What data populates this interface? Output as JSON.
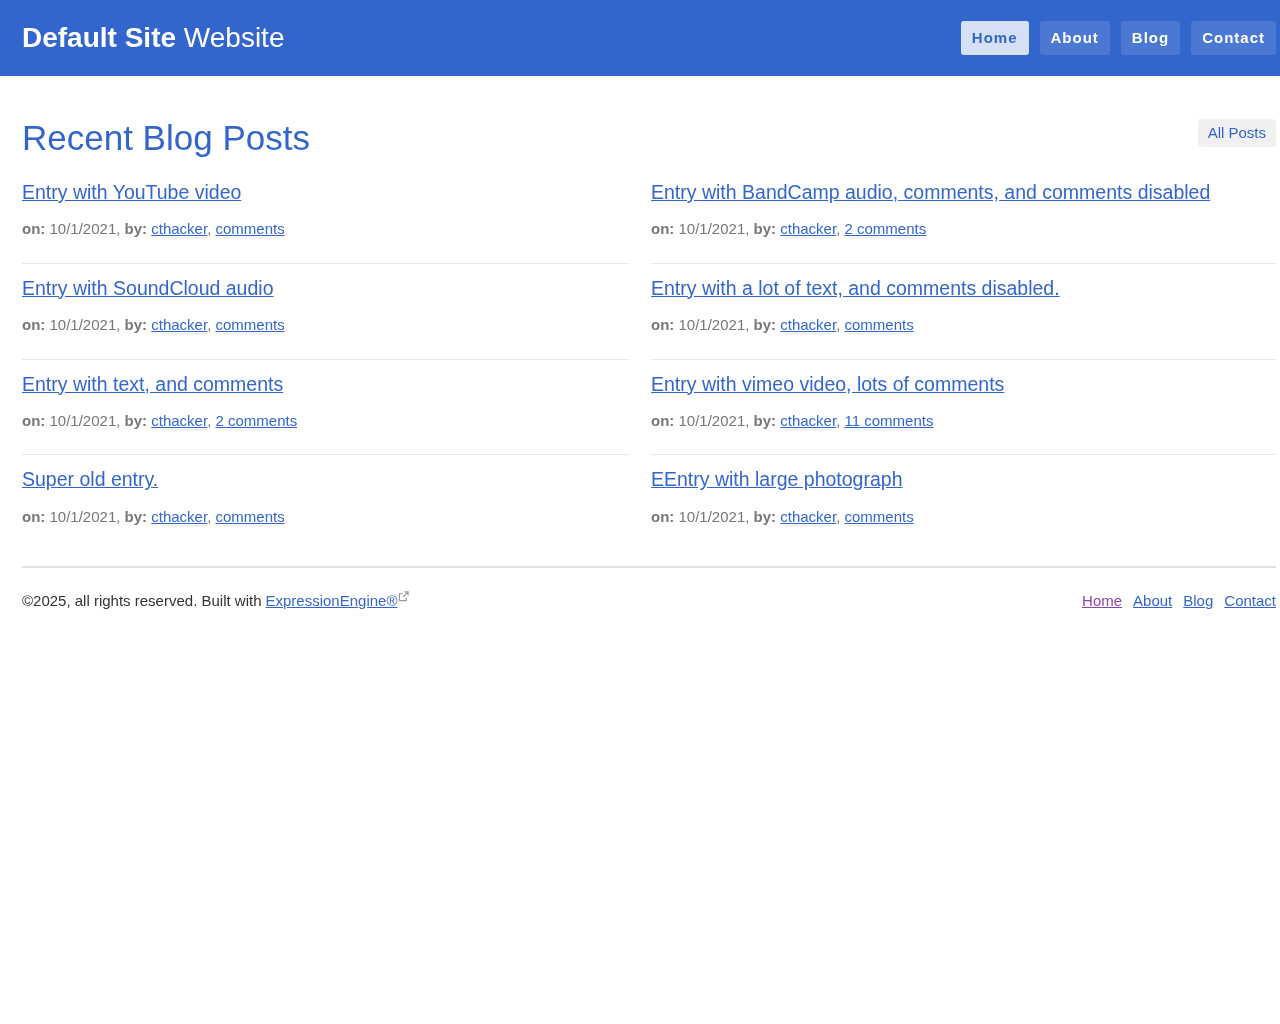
{
  "header": {
    "site_name": "Default Site",
    "site_suffix": "Website",
    "nav": [
      {
        "label": "Home",
        "selected": true
      },
      {
        "label": "About",
        "selected": false
      },
      {
        "label": "Blog",
        "selected": false
      },
      {
        "label": "Contact",
        "selected": false
      }
    ]
  },
  "main": {
    "title": "Recent Blog Posts",
    "all_posts_button": "All Posts",
    "posts": [
      {
        "title": "Entry with YouTube video",
        "on_label": "on:",
        "date": "10/1/2021,",
        "by_label": "by:",
        "author": "cthacker",
        "separator": ",",
        "comments": "comments"
      },
      {
        "title": "Entry with BandCamp audio, comments, and comments disabled",
        "on_label": "on:",
        "date": "10/1/2021,",
        "by_label": "by:",
        "author": "cthacker",
        "separator": ",",
        "comments": "2 comments"
      },
      {
        "title": "Entry with SoundCloud audio",
        "on_label": "on:",
        "date": "10/1/2021,",
        "by_label": "by:",
        "author": "cthacker",
        "separator": ",",
        "comments": "comments"
      },
      {
        "title": "Entry with a lot of text, and comments disabled.",
        "on_label": "on:",
        "date": "10/1/2021,",
        "by_label": "by:",
        "author": "cthacker",
        "separator": ",",
        "comments": "comments"
      },
      {
        "title": "Entry with text, and comments",
        "on_label": "on:",
        "date": "10/1/2021,",
        "by_label": "by:",
        "author": "cthacker",
        "separator": ",",
        "comments": "2 comments"
      },
      {
        "title": "Entry with vimeo video, lots of comments",
        "on_label": "on:",
        "date": "10/1/2021,",
        "by_label": "by:",
        "author": "cthacker",
        "separator": ",",
        "comments": "11 comments"
      },
      {
        "title": "Super old entry.",
        "on_label": "on:",
        "date": "10/1/2021,",
        "by_label": "by:",
        "author": "cthacker",
        "separator": ",",
        "comments": "comments"
      },
      {
        "title": "EEntry with large photograph",
        "on_label": "on:",
        "date": "10/1/2021,",
        "by_label": "by:",
        "author": "cthacker",
        "separator": ",",
        "comments": "comments"
      }
    ]
  },
  "footer": {
    "copyright": "©2025, all rights reserved. Built with",
    "engine_link": "ExpressionEngine®",
    "links": [
      {
        "label": "Home",
        "visited": true
      },
      {
        "label": "About",
        "visited": false
      },
      {
        "label": "Blog",
        "visited": false
      },
      {
        "label": "Contact",
        "visited": false
      }
    ]
  }
}
